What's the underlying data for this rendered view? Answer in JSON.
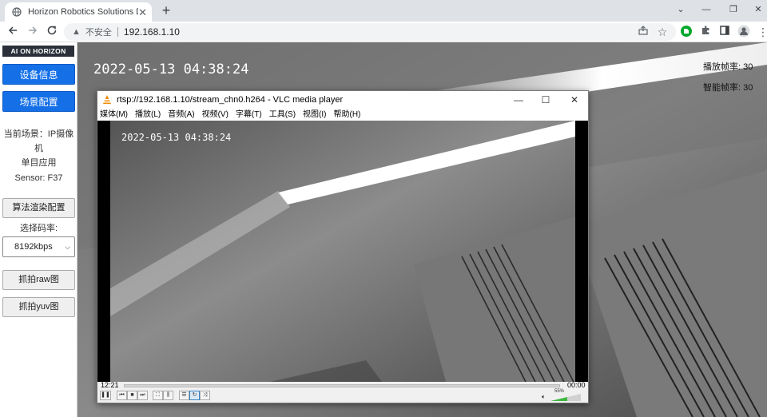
{
  "browser": {
    "tab_title": "Horizon Robotics Solutions Demo",
    "new_tab": "+",
    "tab_close": "✕",
    "window_controls": [
      "⌄",
      "—",
      "❐",
      "✕"
    ],
    "insecure_label": "不安全",
    "url": "192.168.1.10"
  },
  "sidebar": {
    "logo": "AI ON HORIZON",
    "device_info_button": "设备信息",
    "scene_config_button": "场景配置",
    "current_scene_label": "当前场景：",
    "current_scene_value_1": "IP摄像",
    "current_scene_value_2": "机",
    "app_mode": "单目应用",
    "sensor": "Sensor: F37",
    "algo_render_button": "算法渲染配置",
    "bitrate_label": "选择码率:",
    "bitrate_selected": "8192kbps",
    "capture_raw_button": "抓拍raw图",
    "capture_yuv_button": "抓拍yuv图"
  },
  "main": {
    "timestamp": "2022-05-13 04:38:24",
    "play_fps": "播放帧率: 30",
    "smart_fps": "智能帧率: 30"
  },
  "vlc": {
    "title": "rtsp://192.168.1.10/stream_chn0.h264 - VLC media player",
    "menu": [
      "媒体(M)",
      "播放(L)",
      "音频(A)",
      "视频(V)",
      "字幕(T)",
      "工具(S)",
      "视图(I)",
      "帮助(H)"
    ],
    "video_timestamp": "2022-05-13 04:38:24",
    "elapsed": "12:21",
    "remaining": "00:00",
    "volume": "55%",
    "volume_level": 0.55
  }
}
